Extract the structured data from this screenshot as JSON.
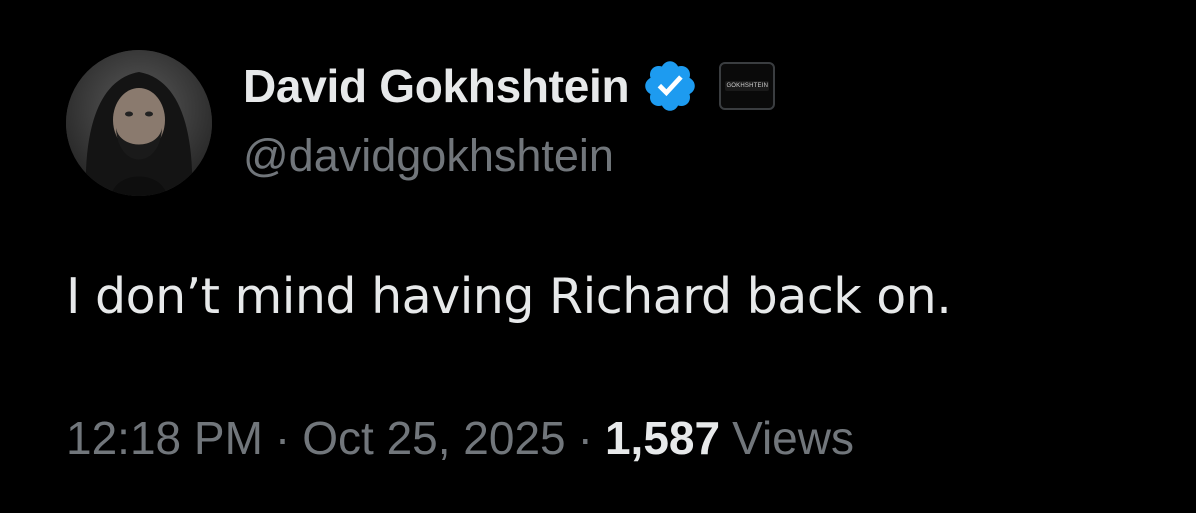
{
  "author": {
    "display_name": "David Gokhshtein",
    "handle": "@davidgokhshtein",
    "verified_badge_color": "#1d9bf0",
    "avatar_icon": "avatar-photo",
    "affiliate_badge_text": "GOKHSHTEIN"
  },
  "tweet": {
    "text": "I don’t mind having Richard back on.",
    "time": "12:18 PM",
    "separator": "·",
    "date": "Oct 25, 2025",
    "views_count": "1,587",
    "views_label": "Views"
  },
  "colors": {
    "background": "#000000",
    "primary_text": "#e7e9ea",
    "secondary_text": "#71767b",
    "verified_blue": "#1d9bf0"
  }
}
